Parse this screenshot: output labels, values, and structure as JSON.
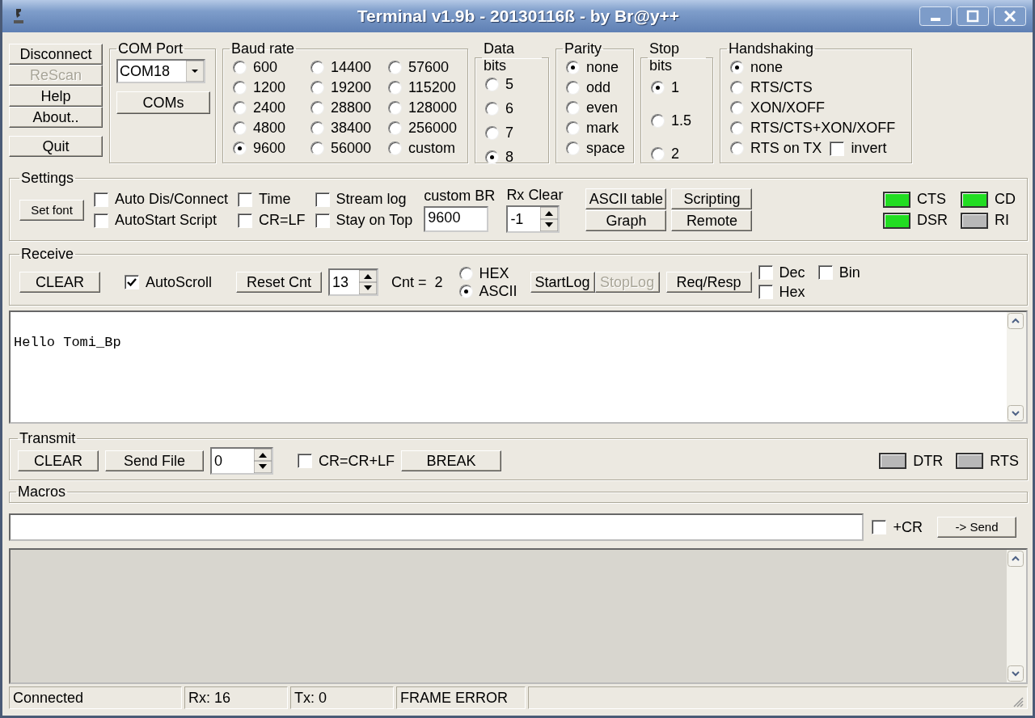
{
  "window": {
    "title": "Terminal v1.9b - 20130116ß - by Br@y++"
  },
  "left_buttons": [
    {
      "label": "Disconnect",
      "disabled": false
    },
    {
      "label": "ReScan",
      "disabled": true
    },
    {
      "label": "Help",
      "disabled": false
    },
    {
      "label": "About..",
      "disabled": false
    },
    {
      "label": "Quit",
      "disabled": false
    }
  ],
  "com_port": {
    "title": "COM Port",
    "value": "COM18",
    "button": "COMs"
  },
  "baud_rate": {
    "title": "Baud rate",
    "options": [
      {
        "label": "600",
        "selected": false
      },
      {
        "label": "1200",
        "selected": false
      },
      {
        "label": "2400",
        "selected": false
      },
      {
        "label": "4800",
        "selected": false
      },
      {
        "label": "9600",
        "selected": true
      },
      {
        "label": "14400",
        "selected": false
      },
      {
        "label": "19200",
        "selected": false
      },
      {
        "label": "28800",
        "selected": false
      },
      {
        "label": "38400",
        "selected": false
      },
      {
        "label": "56000",
        "selected": false
      },
      {
        "label": "57600",
        "selected": false
      },
      {
        "label": "115200",
        "selected": false
      },
      {
        "label": "128000",
        "selected": false
      },
      {
        "label": "256000",
        "selected": false
      },
      {
        "label": "custom",
        "selected": false
      }
    ]
  },
  "data_bits": {
    "title": "Data bits",
    "options": [
      {
        "label": "5",
        "selected": false
      },
      {
        "label": "6",
        "selected": false
      },
      {
        "label": "7",
        "selected": false
      },
      {
        "label": "8",
        "selected": true
      }
    ]
  },
  "parity": {
    "title": "Parity",
    "options": [
      {
        "label": "none",
        "selected": true
      },
      {
        "label": "odd",
        "selected": false
      },
      {
        "label": "even",
        "selected": false
      },
      {
        "label": "mark",
        "selected": false
      },
      {
        "label": "space",
        "selected": false
      }
    ]
  },
  "stop_bits": {
    "title": "Stop bits",
    "options": [
      {
        "label": "1",
        "selected": true
      },
      {
        "label": "1.5",
        "selected": false
      },
      {
        "label": "2",
        "selected": false
      }
    ]
  },
  "handshaking": {
    "title": "Handshaking",
    "options": [
      {
        "label": "none",
        "selected": true
      },
      {
        "label": "RTS/CTS",
        "selected": false
      },
      {
        "label": "XON/XOFF",
        "selected": false
      },
      {
        "label": "RTS/CTS+XON/XOFF",
        "selected": false
      },
      {
        "label": "RTS on TX",
        "selected": false
      }
    ],
    "invert": {
      "label": "invert",
      "checked": false
    }
  },
  "settings": {
    "title": "Settings",
    "set_font": "Set font",
    "checkboxes": [
      {
        "label": "Auto Dis/Connect",
        "checked": false
      },
      {
        "label": "AutoStart Script",
        "checked": false
      },
      {
        "label": "Time",
        "checked": false
      },
      {
        "label": "CR=LF",
        "checked": false
      },
      {
        "label": "Stream log",
        "checked": false
      },
      {
        "label": "Stay on Top",
        "checked": false
      }
    ],
    "custom_br": {
      "label": "custom BR",
      "value": "9600"
    },
    "rx_clear": {
      "label": "Rx Clear",
      "value": "-1"
    },
    "buttons": [
      "ASCII table",
      "Graph",
      "Scripting",
      "Remote"
    ],
    "indicators": [
      {
        "label": "CTS",
        "on": true
      },
      {
        "label": "DSR",
        "on": true
      },
      {
        "label": "CD",
        "on": true
      },
      {
        "label": "RI",
        "on": false
      }
    ]
  },
  "receive": {
    "title": "Receive",
    "clear": "CLEAR",
    "autoscroll": {
      "label": "AutoScroll",
      "checked": true
    },
    "reset_cnt": "Reset Cnt",
    "spin_value": "13",
    "count": "Cnt =  2",
    "modes": [
      {
        "label": "HEX",
        "selected": false
      },
      {
        "label": "ASCII",
        "selected": true
      }
    ],
    "log_buttons": [
      {
        "label": "StartLog",
        "disabled": false
      },
      {
        "label": "StopLog",
        "disabled": true
      }
    ],
    "req_resp": "Req/Resp",
    "checkboxes": [
      {
        "label": "Dec",
        "checked": false
      },
      {
        "label": "Hex",
        "checked": false
      },
      {
        "label": "Bin",
        "checked": false
      }
    ],
    "text": "Hello Tomi_Bp"
  },
  "transmit": {
    "title": "Transmit",
    "clear": "CLEAR",
    "send_file": "Send File",
    "spin_value": "0",
    "cr_crlf": {
      "label": "CR=CR+LF",
      "checked": false
    },
    "break": "BREAK",
    "indicators": [
      {
        "label": "DTR",
        "on": false
      },
      {
        "label": "RTS",
        "on": false
      }
    ]
  },
  "macros": {
    "title": "Macros"
  },
  "send_row": {
    "add_cr": {
      "label": "+CR",
      "checked": false
    },
    "button": "-> Send"
  },
  "status_bar": [
    "Connected",
    "Rx: 16",
    "Tx: 0",
    "FRAME ERROR"
  ]
}
